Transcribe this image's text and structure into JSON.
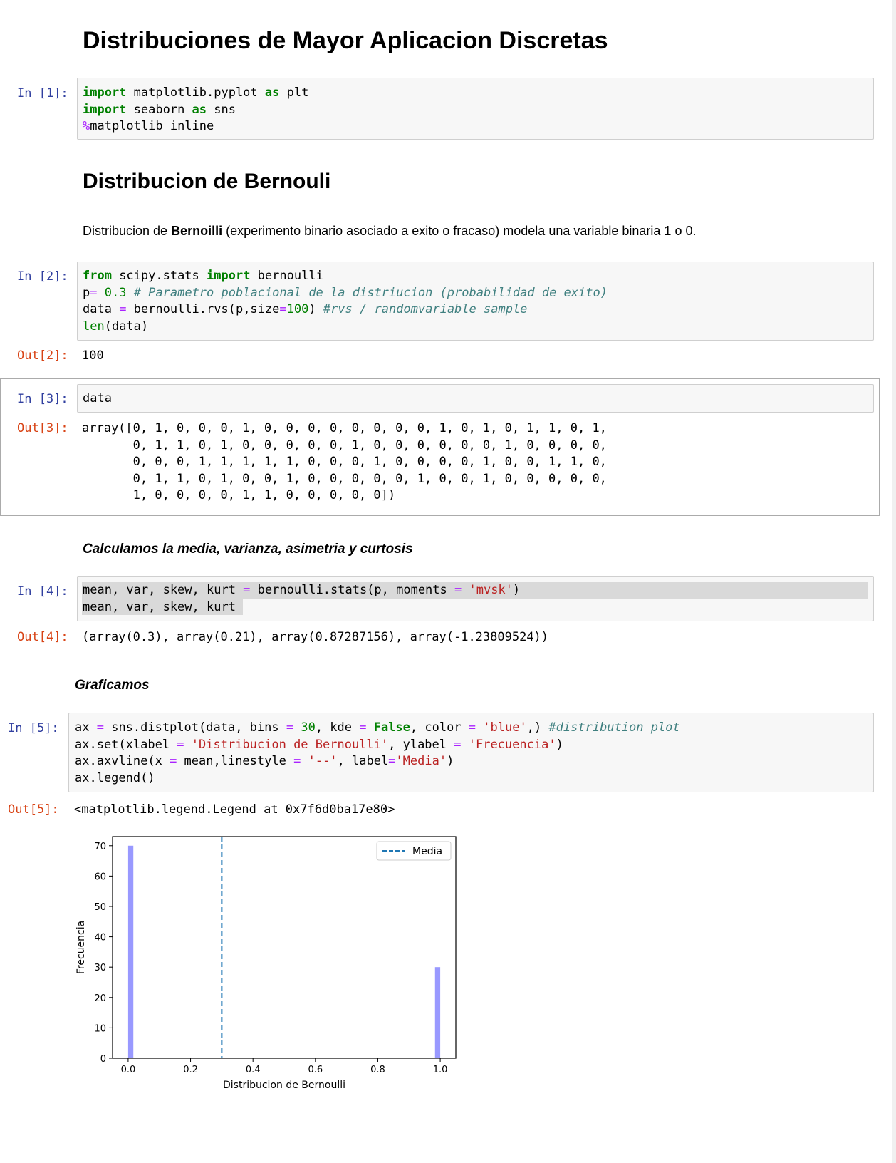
{
  "title": "Distribuciones de Mayor Aplicacion Discretas",
  "section_title": "Distribucion de Bernouli",
  "paragraph": {
    "before": "Distribucion de ",
    "bold": "Bernoilli",
    "after": " (experimento binario asociado a exito o fracaso) modela una variable binaria 1 o 0."
  },
  "heading_stats": "Calculamos la media, varianza, asimetria y curtosis",
  "heading_plot": "Graficamos",
  "prompts": {
    "in1": "In [1]:",
    "in2": "In [2]:",
    "out2": "Out[2]:",
    "in3": "In [3]:",
    "out3": "Out[3]:",
    "in4": "In [4]:",
    "out4": "Out[4]:",
    "in5": "In [5]:",
    "out5": "Out[5]:"
  },
  "cell1": {
    "l1_kw": "import",
    "l1_mod": " matplotlib.pyplot ",
    "l1_as": "as",
    "l1_name": " plt",
    "l2_kw": "import",
    "l2_mod": " seaborn ",
    "l2_as": "as",
    "l2_name": " sns",
    "l3_pct": "%",
    "l3_rest": "matplotlib inline"
  },
  "cell2": {
    "l1_from": "from",
    "l1_mod": " scipy.stats ",
    "l1_import": "import",
    "l1_name": " bernoulli",
    "l2_var": "p",
    "l2_eq": "=",
    "l2_num": " 0.3 ",
    "l2_cm": "# Parametro poblacional de la distriucion (probabilidad de exito)",
    "l3_a": "data ",
    "l3_eq": "=",
    "l3_b": " bernoulli.rvs(p,size",
    "l3_eq2": "=",
    "l3_num": "100",
    "l3_c": ") ",
    "l3_cm": "#rvs / randomvariable sample",
    "l4_fn": "len",
    "l4_rest": "(data)"
  },
  "out2": "100",
  "cell3": "data",
  "out3": [
    "array([0, 1, 0, 0, 0, 1, 0, 0, 0, 0, 0, 0, 0, 0, 1, 0, 1, 0, 1, 1, 0, 1,",
    "       0, 1, 1, 0, 1, 0, 0, 0, 0, 0, 1, 0, 0, 0, 0, 0, 0, 1, 0, 0, 0, 0,",
    "       0, 0, 0, 1, 1, 1, 1, 1, 0, 0, 0, 1, 0, 0, 0, 0, 1, 0, 0, 1, 1, 0,",
    "       0, 1, 1, 0, 1, 0, 0, 1, 0, 0, 0, 0, 0, 1, 0, 0, 1, 0, 0, 0, 0, 0,",
    "       1, 0, 0, 0, 0, 1, 1, 0, 0, 0, 0, 0])"
  ],
  "cell4": {
    "l1_a": "mean, var, skew, kurt ",
    "l1_eq": "=",
    "l1_b": " bernoulli.stats(p, moments ",
    "l1_eq2": "=",
    "l1_str": " 'mvsk'",
    "l1_c": ")",
    "l2": "mean, var, skew, kurt"
  },
  "out4": "(array(0.3), array(0.21), array(0.87287156), array(-1.23809524))",
  "cell5": {
    "l1_a": "ax ",
    "l1_eq": "=",
    "l1_b": " sns.distplot(data, bins ",
    "l1_eq2": "=",
    "l1_num": " 30",
    "l1_c": ", kde ",
    "l1_eq3": "=",
    "l1_false": " False",
    "l1_d": ", color ",
    "l1_eq4": "=",
    "l1_str": " 'blue'",
    "l1_e": ",) ",
    "l1_cm": "#distribution plot",
    "l2_a": "ax.set(xlabel ",
    "l2_eq": "=",
    "l2_str1": " 'Distribucion de Bernoulli'",
    "l2_b": ", ylabel ",
    "l2_eq2": "=",
    "l2_str2": " 'Frecuencia'",
    "l2_c": ")",
    "l3_a": "ax.axvline(x ",
    "l3_eq": "=",
    "l3_b": " mean,linestyle ",
    "l3_eq2": "=",
    "l3_str1": " '--'",
    "l3_c": ", label",
    "l3_eq3": "=",
    "l3_str2": "'Media'",
    "l3_d": ")",
    "l4": "ax.legend()"
  },
  "out5": "<matplotlib.legend.Legend at 0x7f6d0ba17e80>",
  "chart_data": {
    "type": "bar",
    "xlabel": "Distribucion de Bernoulli",
    "ylabel": "Frecuencia",
    "x": [
      0.0,
      1.0
    ],
    "values": [
      70,
      30
    ],
    "bar_color": "#9999ff",
    "xlim": [
      -0.05,
      1.05
    ],
    "ylim": [
      0,
      73
    ],
    "xticks": [
      "0.0",
      "0.2",
      "0.4",
      "0.6",
      "0.8",
      "1.0"
    ],
    "xtick_values": [
      0.0,
      0.2,
      0.4,
      0.6,
      0.8,
      1.0
    ],
    "yticks": [
      "0",
      "10",
      "20",
      "30",
      "40",
      "50",
      "60",
      "70"
    ],
    "ytick_values": [
      0,
      10,
      20,
      30,
      40,
      50,
      60,
      70
    ],
    "vline": {
      "x": 0.3,
      "label": "Media",
      "color": "#1f77b4",
      "linestyle": "--"
    },
    "legend": {
      "label": "Media",
      "placement": "top-right"
    },
    "grid": false
  }
}
